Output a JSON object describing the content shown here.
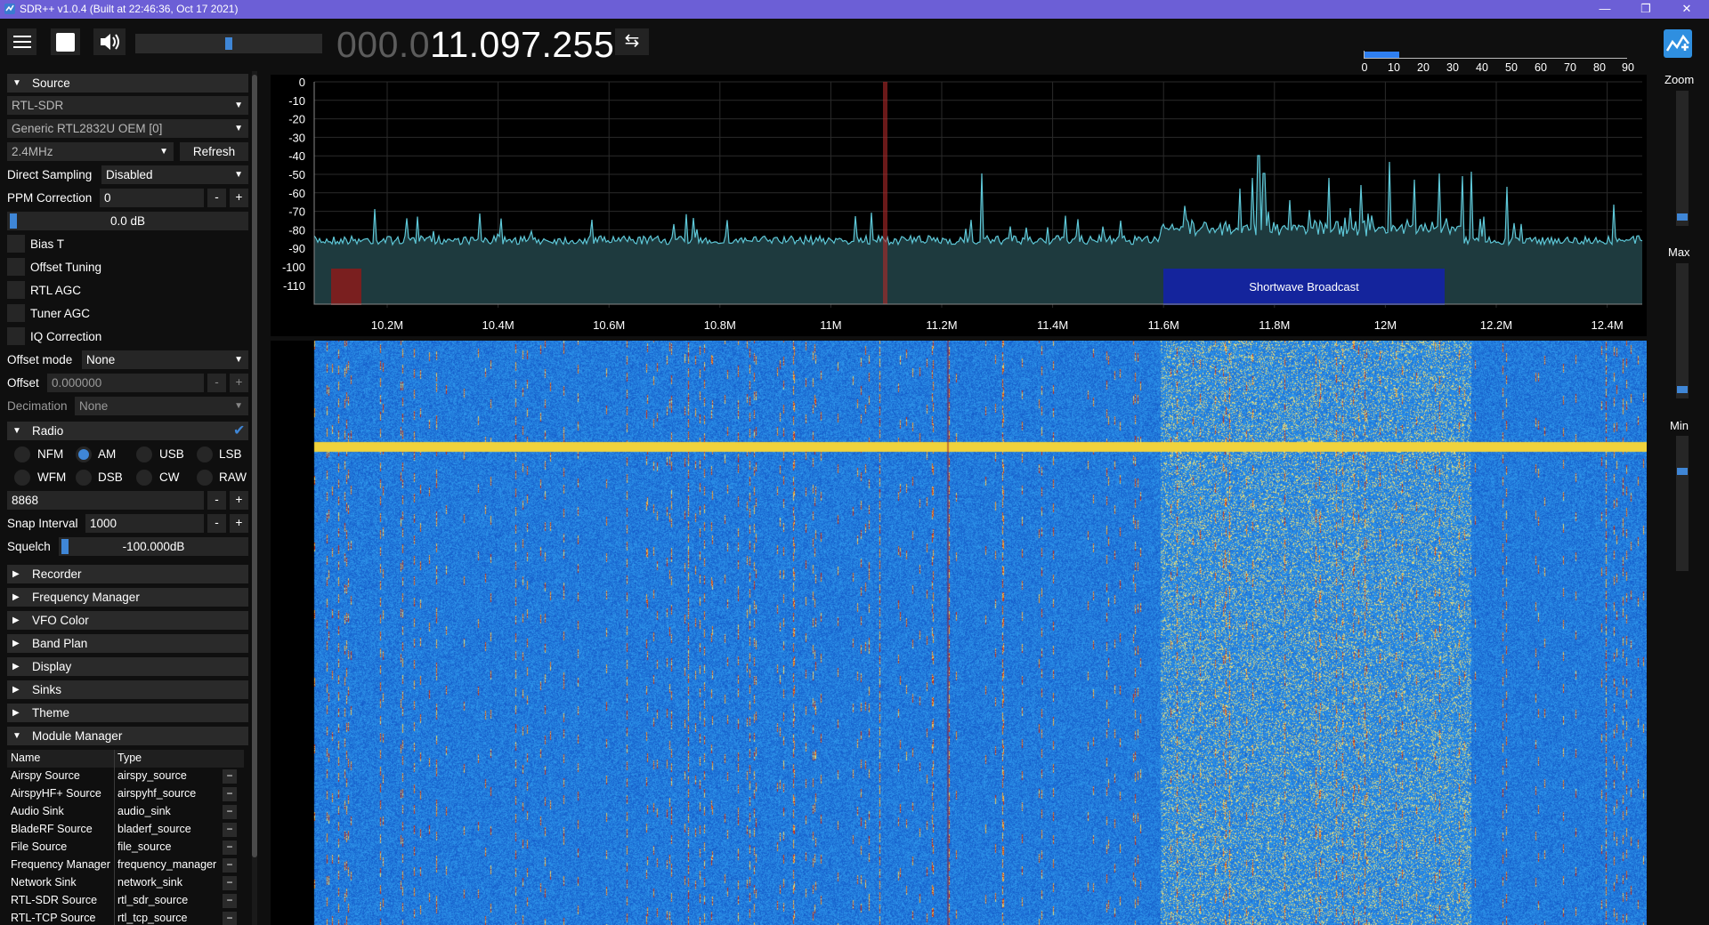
{
  "window": {
    "title": "SDR++ v1.0.4 (Built at 22:46:36, Oct 17 2021)",
    "minimize": "—",
    "restore": "❐",
    "close": "✕"
  },
  "toolbar": {
    "frequency_dim": "000.0",
    "frequency_bright": "11.097.255",
    "swap_glyph": "⇆",
    "volume_level": 0.5,
    "snr_ticks": [
      "0",
      "10",
      "20",
      "30",
      "40",
      "50",
      "60",
      "70",
      "80",
      "90"
    ],
    "snr_level": 12
  },
  "source": {
    "header": "Source",
    "device_type": "RTL-SDR",
    "device": "Generic RTL2832U OEM [0]",
    "sample_rate": "2.4MHz",
    "refresh": "Refresh",
    "direct_sampling_label": "Direct Sampling",
    "direct_sampling_value": "Disabled",
    "ppm_label": "PPM Correction",
    "ppm_value": "0",
    "gain": "0.0 dB",
    "bias_t": "Bias T",
    "offset_tuning": "Offset Tuning",
    "rtl_agc": "RTL AGC",
    "tuner_agc": "Tuner AGC",
    "iq_correction": "IQ Correction",
    "offset_mode_label": "Offset mode",
    "offset_mode_value": "None",
    "offset_label": "Offset",
    "offset_value": "0.000000",
    "decimation_label": "Decimation",
    "decimation_value": "None"
  },
  "radio": {
    "header": "Radio",
    "modes": [
      "NFM",
      "AM",
      "USB",
      "LSB",
      "WFM",
      "DSB",
      "CW",
      "RAW"
    ],
    "selected_mode": "AM",
    "bandwidth": "8868",
    "snap_label": "Snap Interval",
    "snap_value": "1000",
    "squelch_label": "Squelch",
    "squelch_value": "-100.000dB"
  },
  "collapsed_sections": [
    "Recorder",
    "Frequency Manager",
    "VFO Color",
    "Band Plan",
    "Display",
    "Sinks",
    "Theme"
  ],
  "module_manager": {
    "header": "Module Manager",
    "columns": [
      "Name",
      "Type"
    ],
    "rows": [
      [
        "Airspy Source",
        "airspy_source"
      ],
      [
        "AirspyHF+ Source",
        "airspyhf_source"
      ],
      [
        "Audio Sink",
        "audio_sink"
      ],
      [
        "BladeRF Source",
        "bladerf_source"
      ],
      [
        "File Source",
        "file_source"
      ],
      [
        "Frequency Manager",
        "frequency_manager"
      ],
      [
        "Network Sink",
        "network_sink"
      ],
      [
        "RTL-SDR Source",
        "rtl_sdr_source"
      ],
      [
        "RTL-TCP Source",
        "rtl_tcp_source"
      ]
    ],
    "remove": "−"
  },
  "fft": {
    "y_ticks": [
      "0",
      "-10",
      "-20",
      "-30",
      "-40",
      "-50",
      "-60",
      "-70",
      "-80",
      "-90",
      "-100",
      "-110"
    ],
    "x_ticks": [
      "10.2M",
      "10.4M",
      "10.6M",
      "10.8M",
      "11M",
      "11.2M",
      "11.4M",
      "11.6M",
      "11.8M",
      "12M",
      "12.2M",
      "12.4M"
    ],
    "band_label": "Shortwave Broadcast",
    "colors": {
      "trace": "#5ec8d8",
      "fill": "#1e3a3e",
      "vfo": "#7a1f1f",
      "band": "#14249c"
    }
  },
  "right_panel": {
    "zoom": "Zoom",
    "max": "Max",
    "min": "Min"
  }
}
